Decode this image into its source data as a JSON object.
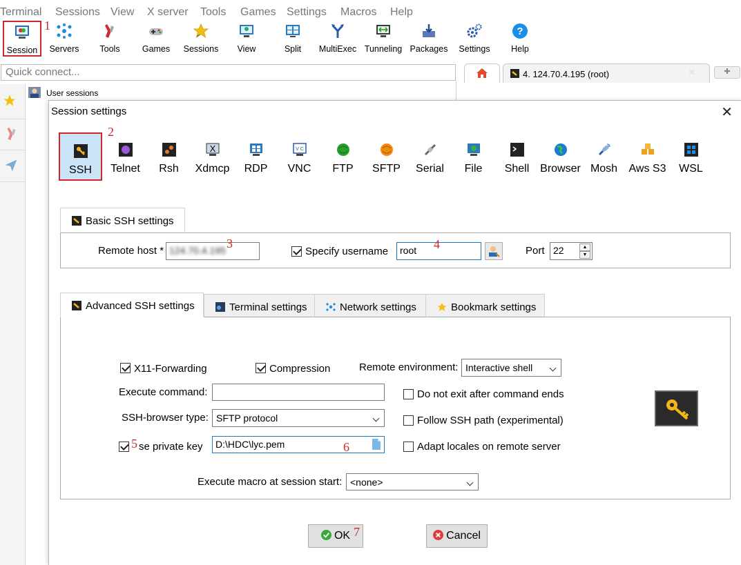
{
  "menubar": [
    "Terminal",
    "Sessions",
    "View",
    "X server",
    "Tools",
    "Games",
    "Settings",
    "Macros",
    "Help"
  ],
  "toolbar": [
    {
      "label": "Session",
      "icon": "session-icon"
    },
    {
      "label": "Servers",
      "icon": "servers-icon"
    },
    {
      "label": "Tools",
      "icon": "tools-icon"
    },
    {
      "label": "Games",
      "icon": "games-icon"
    },
    {
      "label": "Sessions",
      "icon": "star-icon"
    },
    {
      "label": "View",
      "icon": "view-icon"
    },
    {
      "label": "Split",
      "icon": "split-icon"
    },
    {
      "label": "MultiExec",
      "icon": "multiexec-icon"
    },
    {
      "label": "Tunneling",
      "icon": "tunneling-icon"
    },
    {
      "label": "Packages",
      "icon": "packages-icon"
    },
    {
      "label": "Settings",
      "icon": "settings-icon"
    },
    {
      "label": "Help",
      "icon": "help-icon"
    }
  ],
  "quick_connect": {
    "placeholder": "Quick connect..."
  },
  "tabs": {
    "session_tab": "4. 124.70.4.195 (root)"
  },
  "sidebar": {
    "user_sessions": "User sessions"
  },
  "annotations": {
    "n1": "1",
    "n2": "2",
    "n3": "3",
    "n4": "4",
    "n5": "5",
    "n6": "6",
    "n7": "7"
  },
  "dialog": {
    "title": "Session settings",
    "close": "✕",
    "session_types": [
      "SSH",
      "Telnet",
      "Rsh",
      "Xdmcp",
      "RDP",
      "VNC",
      "FTP",
      "SFTP",
      "Serial",
      "File",
      "Shell",
      "Browser",
      "Mosh",
      "Aws S3",
      "WSL"
    ],
    "basic_tab": "Basic SSH settings",
    "remote_host_label": "Remote host *",
    "remote_host_value": "124.70.4.195",
    "specify_username_label": "Specify username",
    "username_value": "root",
    "port_label": "Port",
    "port_value": "22",
    "adv_tabs": [
      "Advanced SSH settings",
      "Terminal settings",
      "Network settings",
      "Bookmark settings"
    ],
    "x11_label": "X11-Forwarding",
    "compression_label": "Compression",
    "remote_env_label": "Remote environment:",
    "remote_env_value": "Interactive shell",
    "exec_cmd_label": "Execute command:",
    "exec_cmd_value": "",
    "no_exit_label": "Do not exit after command ends",
    "ssh_browser_label": "SSH-browser type:",
    "ssh_browser_value": "SFTP protocol",
    "follow_path_label": "Follow SSH path (experimental)",
    "private_key_label": "se private key",
    "private_key_value": "D:\\HDC\\lyc.pem",
    "adapt_locales_label": "Adapt locales on remote server",
    "macro_label": "Execute macro at session start:",
    "macro_value": "<none>",
    "ok_label": "OK",
    "cancel_label": "Cancel"
  },
  "colors": {
    "accent_red": "#d0262b",
    "selection_blue": "#cce4f7"
  }
}
